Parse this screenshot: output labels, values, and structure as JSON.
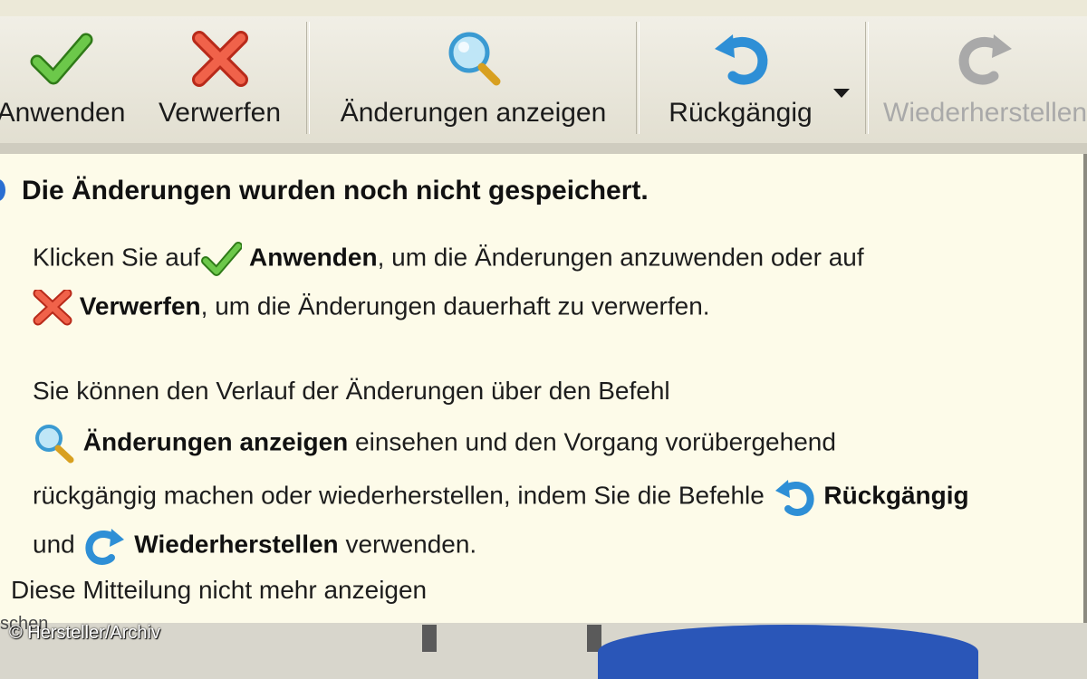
{
  "toolbar": {
    "apply_label": "Anwenden",
    "discard_label": "Verwerfen",
    "show_changes_label": "Änderungen anzeigen",
    "undo_label": "Rückgängig",
    "redo_label": "Wiederherstellen"
  },
  "panel": {
    "headline": "Die Änderungen wurden noch nicht gespeichert.",
    "p1_pre": "Klicken Sie auf",
    "p1_apply": "Anwenden",
    "p1_mid": ", um die Änderungen anzuwenden oder auf",
    "p2_discard": "Verwerfen",
    "p2_rest": ", um die Änderungen dauerhaft zu verwerfen.",
    "p3_line1": "Sie können den Verlauf der Änderungen über den Befehl",
    "p3_show": "Änderungen anzeigen",
    "p3_line2_rest": " einsehen und den Vorgang vorübergehend",
    "p3_line3": "rückgängig machen oder wiederherstellen, indem Sie die Befehle",
    "p3_undo": "Rückgängig",
    "p3_and": "und",
    "p3_redo": "Wiederherstellen",
    "p3_end": " verwenden.",
    "dont_show": "Diese Mitteilung nicht mehr anzeigen"
  },
  "footer": {
    "partial_label": "schen",
    "credit": "© Hersteller/Archiv"
  },
  "icons": [
    "checkmark-icon",
    "cross-icon",
    "magnifier-icon",
    "undo-icon",
    "redo-icon"
  ],
  "colors": {
    "panel_bg": "#fdfbe9",
    "check_green": "#4aa82a",
    "cross_red": "#e0452f",
    "arrow_blue": "#2e8fd6"
  }
}
